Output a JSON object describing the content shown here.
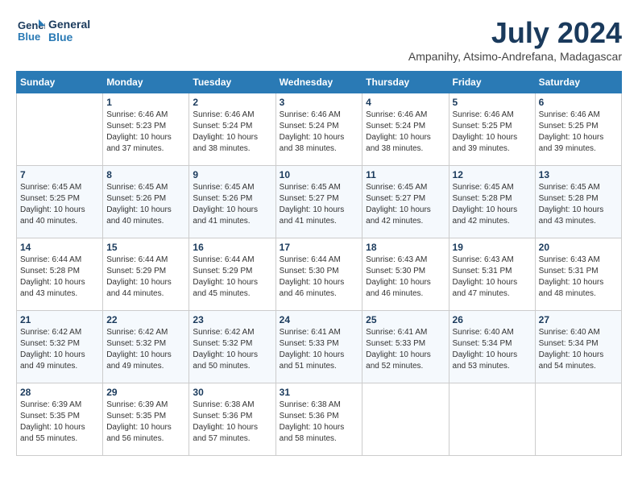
{
  "header": {
    "logo_line1": "General",
    "logo_line2": "Blue",
    "month": "July 2024",
    "location": "Ampanihy, Atsimo-Andrefana, Madagascar"
  },
  "weekdays": [
    "Sunday",
    "Monday",
    "Tuesday",
    "Wednesday",
    "Thursday",
    "Friday",
    "Saturday"
  ],
  "weeks": [
    [
      {
        "num": "",
        "info": ""
      },
      {
        "num": "1",
        "info": "Sunrise: 6:46 AM\nSunset: 5:23 PM\nDaylight: 10 hours\nand 37 minutes."
      },
      {
        "num": "2",
        "info": "Sunrise: 6:46 AM\nSunset: 5:24 PM\nDaylight: 10 hours\nand 38 minutes."
      },
      {
        "num": "3",
        "info": "Sunrise: 6:46 AM\nSunset: 5:24 PM\nDaylight: 10 hours\nand 38 minutes."
      },
      {
        "num": "4",
        "info": "Sunrise: 6:46 AM\nSunset: 5:24 PM\nDaylight: 10 hours\nand 38 minutes."
      },
      {
        "num": "5",
        "info": "Sunrise: 6:46 AM\nSunset: 5:25 PM\nDaylight: 10 hours\nand 39 minutes."
      },
      {
        "num": "6",
        "info": "Sunrise: 6:46 AM\nSunset: 5:25 PM\nDaylight: 10 hours\nand 39 minutes."
      }
    ],
    [
      {
        "num": "7",
        "info": "Sunrise: 6:45 AM\nSunset: 5:25 PM\nDaylight: 10 hours\nand 40 minutes."
      },
      {
        "num": "8",
        "info": "Sunrise: 6:45 AM\nSunset: 5:26 PM\nDaylight: 10 hours\nand 40 minutes."
      },
      {
        "num": "9",
        "info": "Sunrise: 6:45 AM\nSunset: 5:26 PM\nDaylight: 10 hours\nand 41 minutes."
      },
      {
        "num": "10",
        "info": "Sunrise: 6:45 AM\nSunset: 5:27 PM\nDaylight: 10 hours\nand 41 minutes."
      },
      {
        "num": "11",
        "info": "Sunrise: 6:45 AM\nSunset: 5:27 PM\nDaylight: 10 hours\nand 42 minutes."
      },
      {
        "num": "12",
        "info": "Sunrise: 6:45 AM\nSunset: 5:28 PM\nDaylight: 10 hours\nand 42 minutes."
      },
      {
        "num": "13",
        "info": "Sunrise: 6:45 AM\nSunset: 5:28 PM\nDaylight: 10 hours\nand 43 minutes."
      }
    ],
    [
      {
        "num": "14",
        "info": "Sunrise: 6:44 AM\nSunset: 5:28 PM\nDaylight: 10 hours\nand 43 minutes."
      },
      {
        "num": "15",
        "info": "Sunrise: 6:44 AM\nSunset: 5:29 PM\nDaylight: 10 hours\nand 44 minutes."
      },
      {
        "num": "16",
        "info": "Sunrise: 6:44 AM\nSunset: 5:29 PM\nDaylight: 10 hours\nand 45 minutes."
      },
      {
        "num": "17",
        "info": "Sunrise: 6:44 AM\nSunset: 5:30 PM\nDaylight: 10 hours\nand 46 minutes."
      },
      {
        "num": "18",
        "info": "Sunrise: 6:43 AM\nSunset: 5:30 PM\nDaylight: 10 hours\nand 46 minutes."
      },
      {
        "num": "19",
        "info": "Sunrise: 6:43 AM\nSunset: 5:31 PM\nDaylight: 10 hours\nand 47 minutes."
      },
      {
        "num": "20",
        "info": "Sunrise: 6:43 AM\nSunset: 5:31 PM\nDaylight: 10 hours\nand 48 minutes."
      }
    ],
    [
      {
        "num": "21",
        "info": "Sunrise: 6:42 AM\nSunset: 5:32 PM\nDaylight: 10 hours\nand 49 minutes."
      },
      {
        "num": "22",
        "info": "Sunrise: 6:42 AM\nSunset: 5:32 PM\nDaylight: 10 hours\nand 49 minutes."
      },
      {
        "num": "23",
        "info": "Sunrise: 6:42 AM\nSunset: 5:32 PM\nDaylight: 10 hours\nand 50 minutes."
      },
      {
        "num": "24",
        "info": "Sunrise: 6:41 AM\nSunset: 5:33 PM\nDaylight: 10 hours\nand 51 minutes."
      },
      {
        "num": "25",
        "info": "Sunrise: 6:41 AM\nSunset: 5:33 PM\nDaylight: 10 hours\nand 52 minutes."
      },
      {
        "num": "26",
        "info": "Sunrise: 6:40 AM\nSunset: 5:34 PM\nDaylight: 10 hours\nand 53 minutes."
      },
      {
        "num": "27",
        "info": "Sunrise: 6:40 AM\nSunset: 5:34 PM\nDaylight: 10 hours\nand 54 minutes."
      }
    ],
    [
      {
        "num": "28",
        "info": "Sunrise: 6:39 AM\nSunset: 5:35 PM\nDaylight: 10 hours\nand 55 minutes."
      },
      {
        "num": "29",
        "info": "Sunrise: 6:39 AM\nSunset: 5:35 PM\nDaylight: 10 hours\nand 56 minutes."
      },
      {
        "num": "30",
        "info": "Sunrise: 6:38 AM\nSunset: 5:36 PM\nDaylight: 10 hours\nand 57 minutes."
      },
      {
        "num": "31",
        "info": "Sunrise: 6:38 AM\nSunset: 5:36 PM\nDaylight: 10 hours\nand 58 minutes."
      },
      {
        "num": "",
        "info": ""
      },
      {
        "num": "",
        "info": ""
      },
      {
        "num": "",
        "info": ""
      }
    ]
  ]
}
